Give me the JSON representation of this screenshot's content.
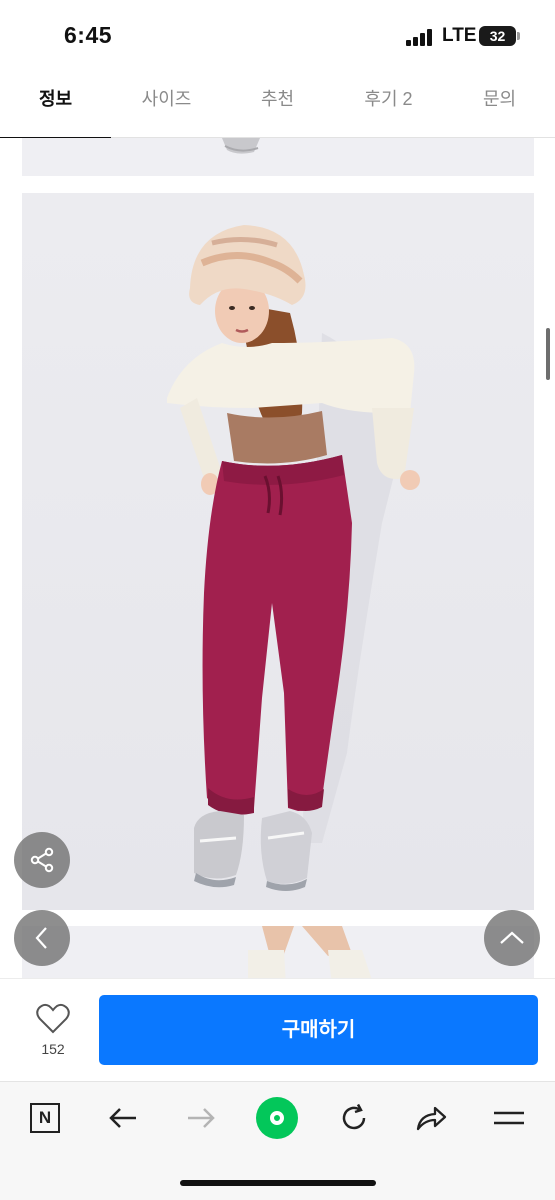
{
  "status": {
    "time": "6:45",
    "network": "LTE",
    "battery": "32"
  },
  "tabs": [
    {
      "label": "정보",
      "active": true
    },
    {
      "label": "사이즈",
      "active": false
    },
    {
      "label": "추천",
      "active": false
    },
    {
      "label": "후기 2",
      "active": false
    },
    {
      "label": "문의",
      "active": false
    }
  ],
  "purchase": {
    "like_count": "152",
    "buy_label": "구매하기",
    "accent": "#0a78ff"
  },
  "toolbar": {
    "icons": [
      "naver-n-icon",
      "back-arrow-icon",
      "forward-arrow-icon",
      "green-dot-icon",
      "refresh-icon",
      "share-icon",
      "menu-icon"
    ],
    "green": "#03c75a"
  },
  "images": {
    "main_photo": "model-wearing-magenta-jogger-pants"
  }
}
